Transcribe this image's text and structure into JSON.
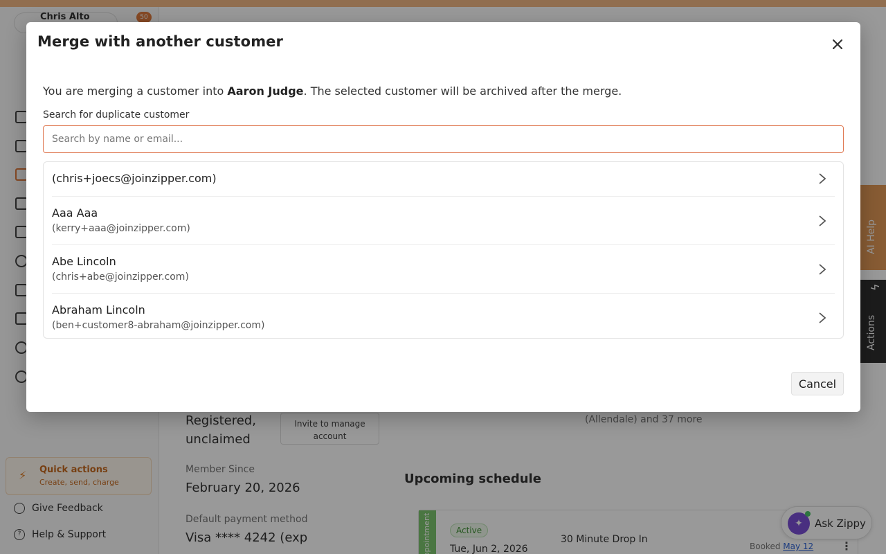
{
  "background": {
    "user_name": "Chris Alto",
    "notification_count": "50",
    "quick_actions": {
      "title": "Quick actions",
      "subtitle": "Create, send, charge"
    },
    "give_feedback": "Give Feedback",
    "help_support": "Help & Support",
    "account_status": "Registered, unclaimed",
    "invite_button": "Invite to manage account",
    "member_since_label": "Member Since",
    "member_since_value": "February 20, 2026",
    "payment_label": "Default payment method",
    "payment_value": "Visa **** 4242 (exp",
    "locations_text": "(Allendale) and 37 more",
    "upcoming_title": "Upcoming schedule",
    "appointment": {
      "stripe_label": "Appointment",
      "status": "Active",
      "date": "Tue, Jun 2, 2026",
      "name": "30 Minute Drop In",
      "booked_label": "Booked",
      "booked_link": "May 12"
    },
    "ai_help_tab": "AI Help",
    "actions_tab": "Actions",
    "ask_zippy": "Ask Zippy"
  },
  "modal": {
    "title": "Merge with another customer",
    "intro": {
      "prefix": "You are merging a customer into ",
      "customer": "Aaron Judge",
      "suffix": ". The selected customer will be archived after the merge."
    },
    "search": {
      "label": "Search for duplicate customer",
      "value": "",
      "placeholder": "Search by name or email..."
    },
    "results": [
      {
        "name": "(chris+joecs@joinzipper.com)",
        "email": ""
      },
      {
        "name": "Aaa Aaa",
        "email": "(kerry+aaa@joinzipper.com)"
      },
      {
        "name": "Abe Lincoln",
        "email": "(chris+abe@joinzipper.com)"
      },
      {
        "name": "Abraham Lincoln",
        "email": "(ben+customer8-abraham@joinzipper.com)"
      }
    ],
    "cancel_label": "Cancel"
  },
  "colors": {
    "search_border": "#e07b55",
    "accent_orange": "#e39a57",
    "zippy_purple": "#7a4fd6"
  }
}
